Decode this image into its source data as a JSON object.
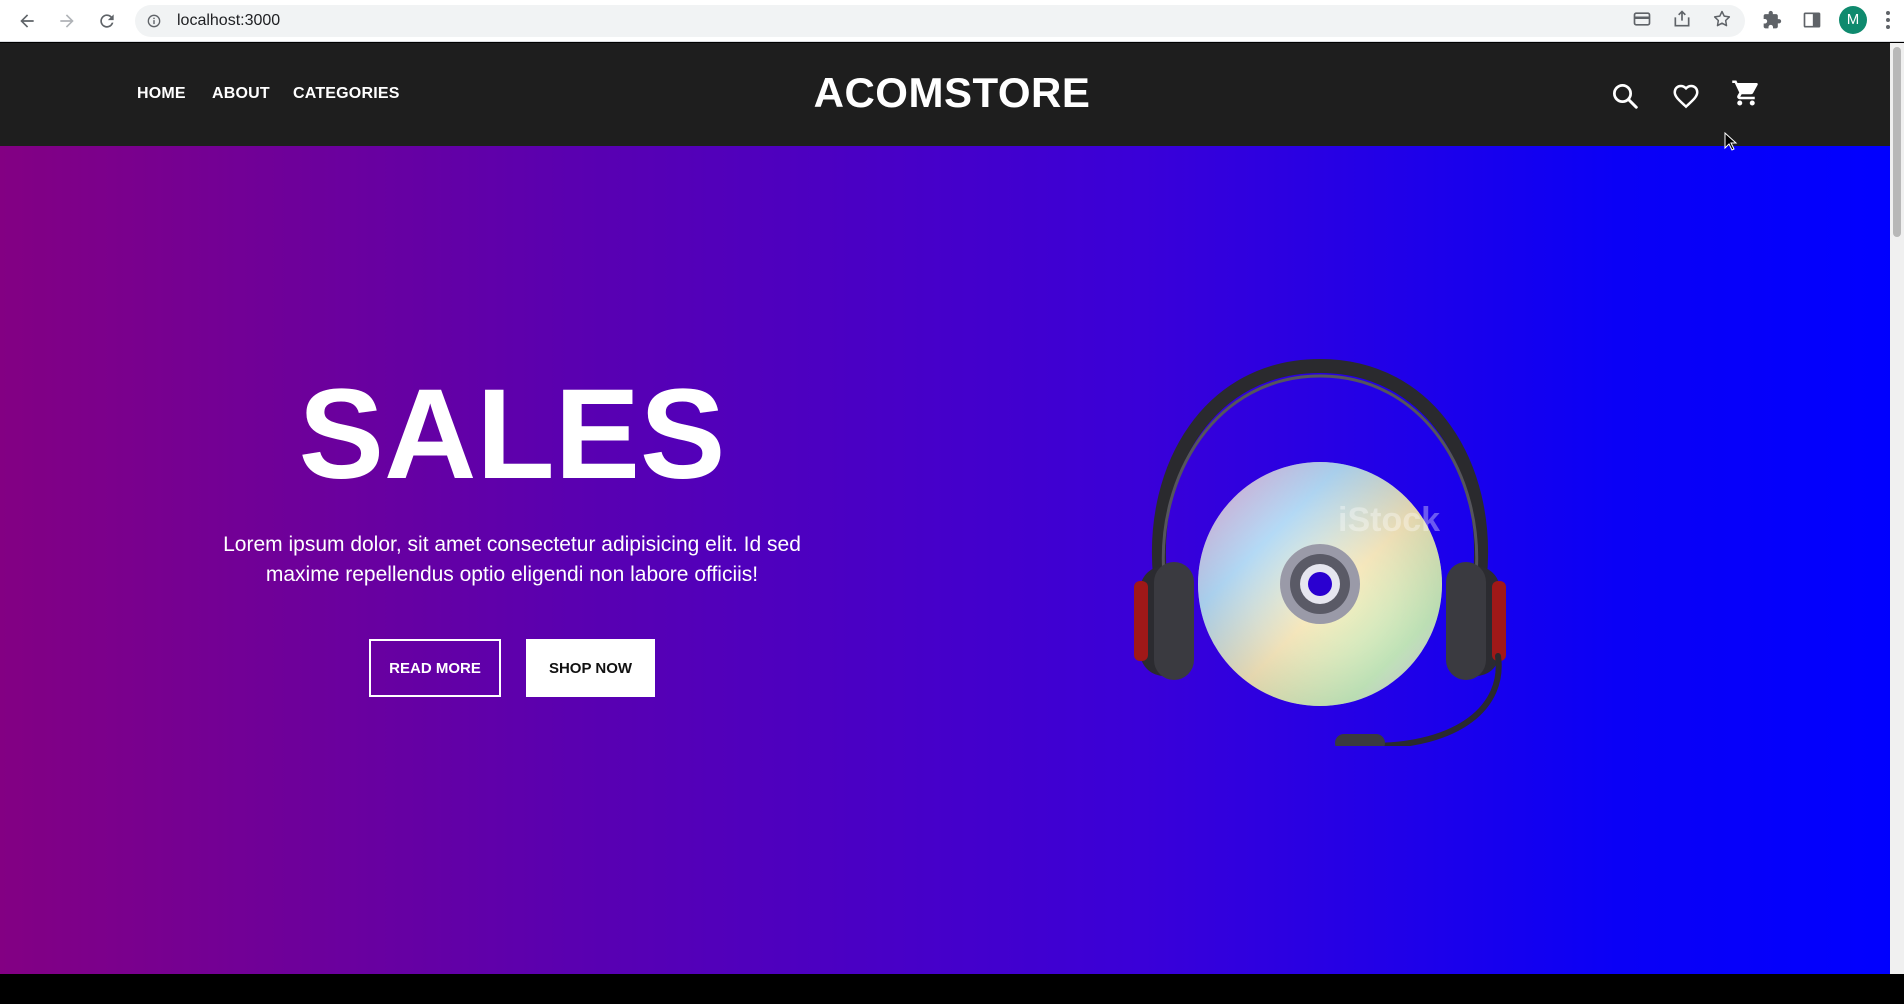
{
  "browser": {
    "url": "localhost:3000",
    "profile_initial": "M",
    "icons": [
      "back-icon",
      "forward-icon",
      "reload-icon",
      "info-icon",
      "card-icon",
      "share-icon",
      "star-icon",
      "extensions-icon",
      "side-panel-icon",
      "more-icon"
    ]
  },
  "header": {
    "nav": [
      {
        "label": "HOME"
      },
      {
        "label": "ABOUT"
      },
      {
        "label": "CATEGORIES"
      }
    ],
    "brand": "ACOMSTORE",
    "icons": [
      "search-icon",
      "heart-icon",
      "cart-icon"
    ]
  },
  "hero": {
    "title": "SALES",
    "text": "Lorem ipsum dolor, sit amet consectetur adipisicing elit. Id sed maxime repellendus optio eligendi non labore officiis!",
    "read_more_label": "READ MORE",
    "shop_now_label": "SHOP NOW",
    "image_alt": "headphones with compact disc",
    "image_watermark": "iStock",
    "gradient_colors": [
      "#830083",
      "#0000ff"
    ]
  },
  "colors": {
    "header_bg": "#1e1e1e",
    "avatar": "#0f8a6e"
  }
}
